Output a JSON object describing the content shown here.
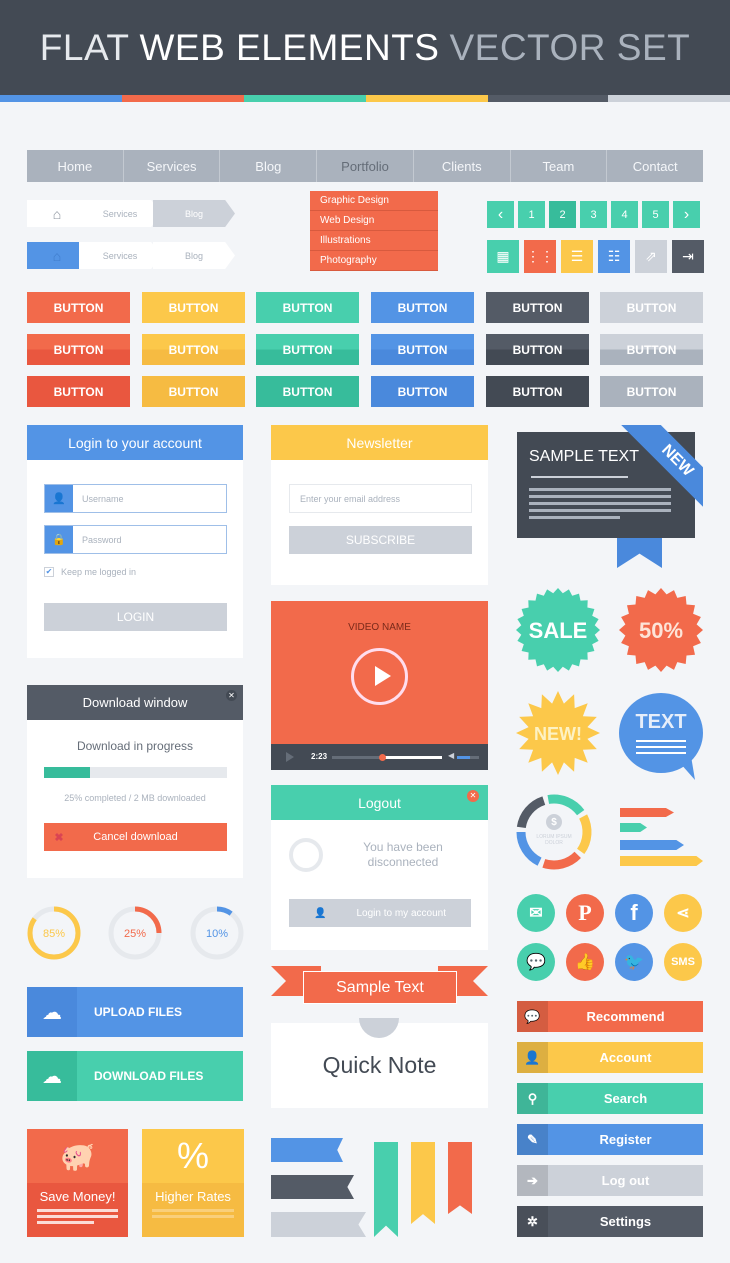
{
  "colors": {
    "red": "#f26a4b",
    "yellow": "#fcc84a",
    "green": "#48cfad",
    "blue": "#5394e5",
    "dark": "#545b66",
    "gray": "#ccd1d9",
    "header": "#434a54"
  },
  "title": {
    "part1": "FLAT",
    "part2": "WEB ELEMENTS",
    "part3": "VECTOR SET"
  },
  "nav": {
    "items": [
      "Home",
      "Services",
      "Blog",
      "Portfolio",
      "Clients",
      "Team",
      "Contact"
    ],
    "active": "Portfolio"
  },
  "dropdown": {
    "items": [
      "Graphic Design",
      "Web Design",
      "Illustrations",
      "Photography"
    ]
  },
  "breadcrumbs": [
    {
      "items": [
        "Services",
        "Blog"
      ],
      "icon": "home-icon"
    },
    {
      "items": [
        "Services",
        "Blog"
      ],
      "icon": "home-icon"
    }
  ],
  "pagination": {
    "prev": "‹",
    "pages": [
      "1",
      "2",
      "3",
      "4",
      "5"
    ],
    "current": "2",
    "next": "›"
  },
  "icon_buttons": [
    "grid-large-icon",
    "grid-small-icon",
    "list-icon",
    "list-detail-icon",
    "share-icon",
    "logout-icon"
  ],
  "buttons": {
    "label": "BUTTON"
  },
  "login": {
    "title": "Login to your account",
    "username_placeholder": "Username",
    "password_placeholder": "Password",
    "remember": "Keep me logged in",
    "remember_checked": true,
    "submit": "LOGIN"
  },
  "newsletter": {
    "title": "Newsletter",
    "email_placeholder": "Enter your email address",
    "submit": "SUBSCRIBE"
  },
  "video": {
    "title": "VIDEO NAME",
    "time": "2:23",
    "progress": 0.45,
    "volume": 0.6
  },
  "download": {
    "title": "Download window",
    "status": "Download in progress",
    "progress": 25,
    "info": "25% completed / 2 MB downloaded",
    "cancel": "Cancel download"
  },
  "logout": {
    "title": "Logout",
    "message1": "You have been",
    "message2": "disconnected",
    "button": "Login to my account"
  },
  "donuts": [
    {
      "label": "85%",
      "value": 85,
      "color": "#fcc84a"
    },
    {
      "label": "25%",
      "value": 25,
      "color": "#f26a4b"
    },
    {
      "label": "10%",
      "value": 10,
      "color": "#5394e5"
    }
  ],
  "upload": {
    "label": "UPLOAD FILES"
  },
  "download_files": {
    "label": "DOWNLOAD FILES"
  },
  "tiles": [
    {
      "label": "Save Money!"
    },
    {
      "label": "Higher Rates"
    }
  ],
  "ribbon": {
    "label": "Sample Text"
  },
  "note": {
    "label": "Quick Note"
  },
  "card": {
    "title": "SAMPLE TEXT",
    "corner": "NEW"
  },
  "badges": {
    "sale": "SALE",
    "fifty": "50%",
    "new": "NEW!",
    "bubble": "TEXT"
  },
  "cycle": {
    "line1": "LORUM IPSUM",
    "line2": "DOLOR",
    "icon": "$"
  },
  "social": [
    "email-icon",
    "pinterest-icon",
    "facebook-icon",
    "share-icon",
    "chat-icon",
    "thumbs-up-icon",
    "twitter-icon",
    "sms-icon"
  ],
  "social_sms": "SMS",
  "menu": [
    {
      "label": "Recommend",
      "icon": "💬"
    },
    {
      "label": "Account",
      "icon": "👤"
    },
    {
      "label": "Search",
      "icon": "⚲"
    },
    {
      "label": "Register",
      "icon": "✎"
    },
    {
      "label": "Log out",
      "icon": "➔"
    },
    {
      "label": "Settings",
      "icon": "✲"
    }
  ]
}
